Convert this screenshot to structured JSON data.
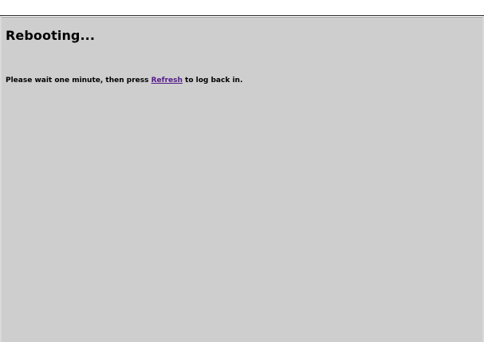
{
  "page": {
    "heading": "Rebooting...",
    "message_before": "Please wait one minute, then press ",
    "refresh_link": "Refresh",
    "message_after": " to log back in.",
    "colors": {
      "background": "#cecece",
      "link_visited": "#551a8b",
      "text": "#000000"
    }
  }
}
